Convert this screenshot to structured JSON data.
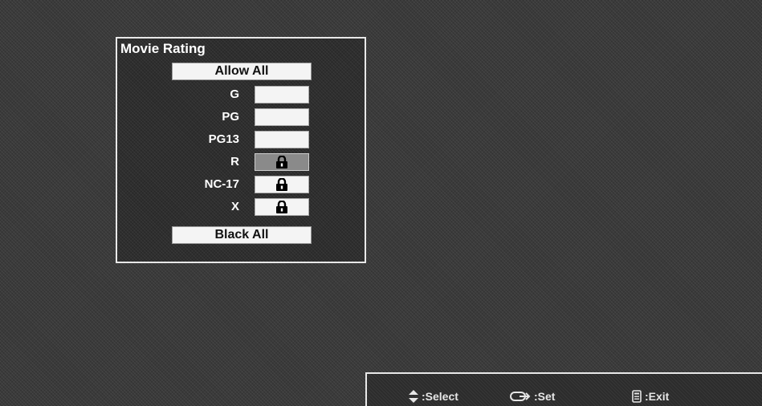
{
  "panel": {
    "title": "Movie Rating",
    "allow_all_label": "Allow All",
    "block_all_label": "Black All",
    "ratings": [
      {
        "label": "G",
        "locked": false
      },
      {
        "label": "PG",
        "locked": false
      },
      {
        "label": "PG13",
        "locked": false
      },
      {
        "label": "R",
        "locked": true,
        "selected": true
      },
      {
        "label": "NC-17",
        "locked": true
      },
      {
        "label": "X",
        "locked": true
      }
    ]
  },
  "footer": {
    "select_label": ":Select",
    "set_label": ":Set",
    "exit_label": ":Exit",
    "select_icon": "up-down-arrows-icon",
    "set_icon": "enter-icon",
    "exit_icon": "remote-icon"
  }
}
